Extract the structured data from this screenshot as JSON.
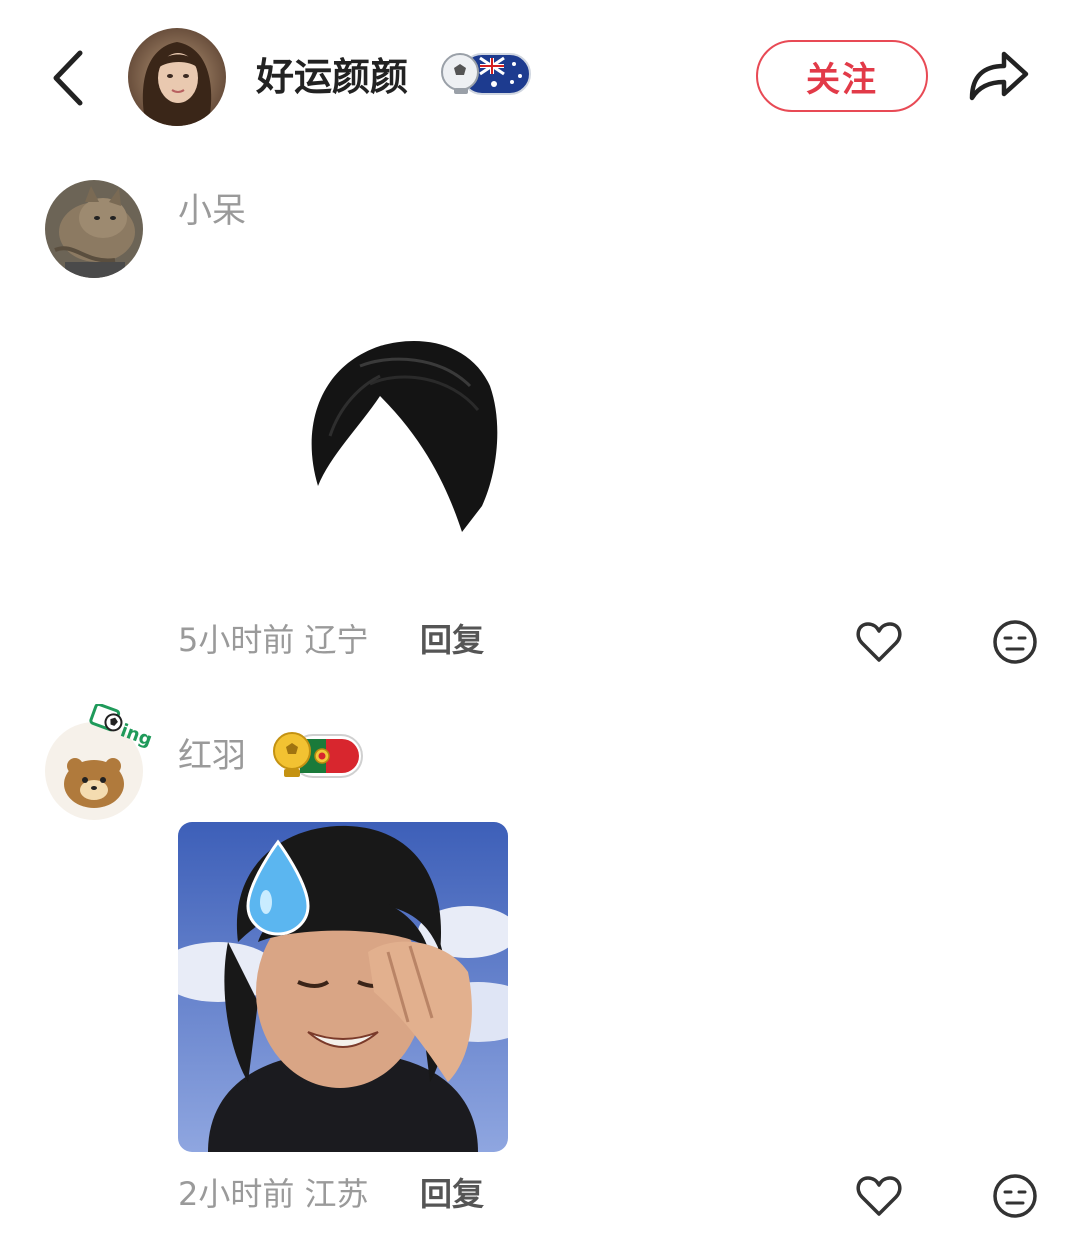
{
  "header": {
    "username": "好运颜颜",
    "follow_label": "关注",
    "icons": [
      "back-arrow-icon",
      "avatar",
      "soccer-trophy-badge",
      "australia-flag",
      "share-arrow-icon"
    ]
  },
  "comments": [
    {
      "username": "小呆",
      "sticker": "hair-wig-sticker",
      "time": "5小时前",
      "location": "辽宁",
      "reply_label": "回复"
    },
    {
      "username": "红羽",
      "badge": [
        "gold-trophy-badge",
        "portugal-flag"
      ],
      "sticker": "sweating-man-meme",
      "time": "2小时前",
      "location": "江苏",
      "reply_label": "回复"
    }
  ],
  "colors": {
    "accent": "#e23a48",
    "meta_text": "#9a9a9a"
  }
}
